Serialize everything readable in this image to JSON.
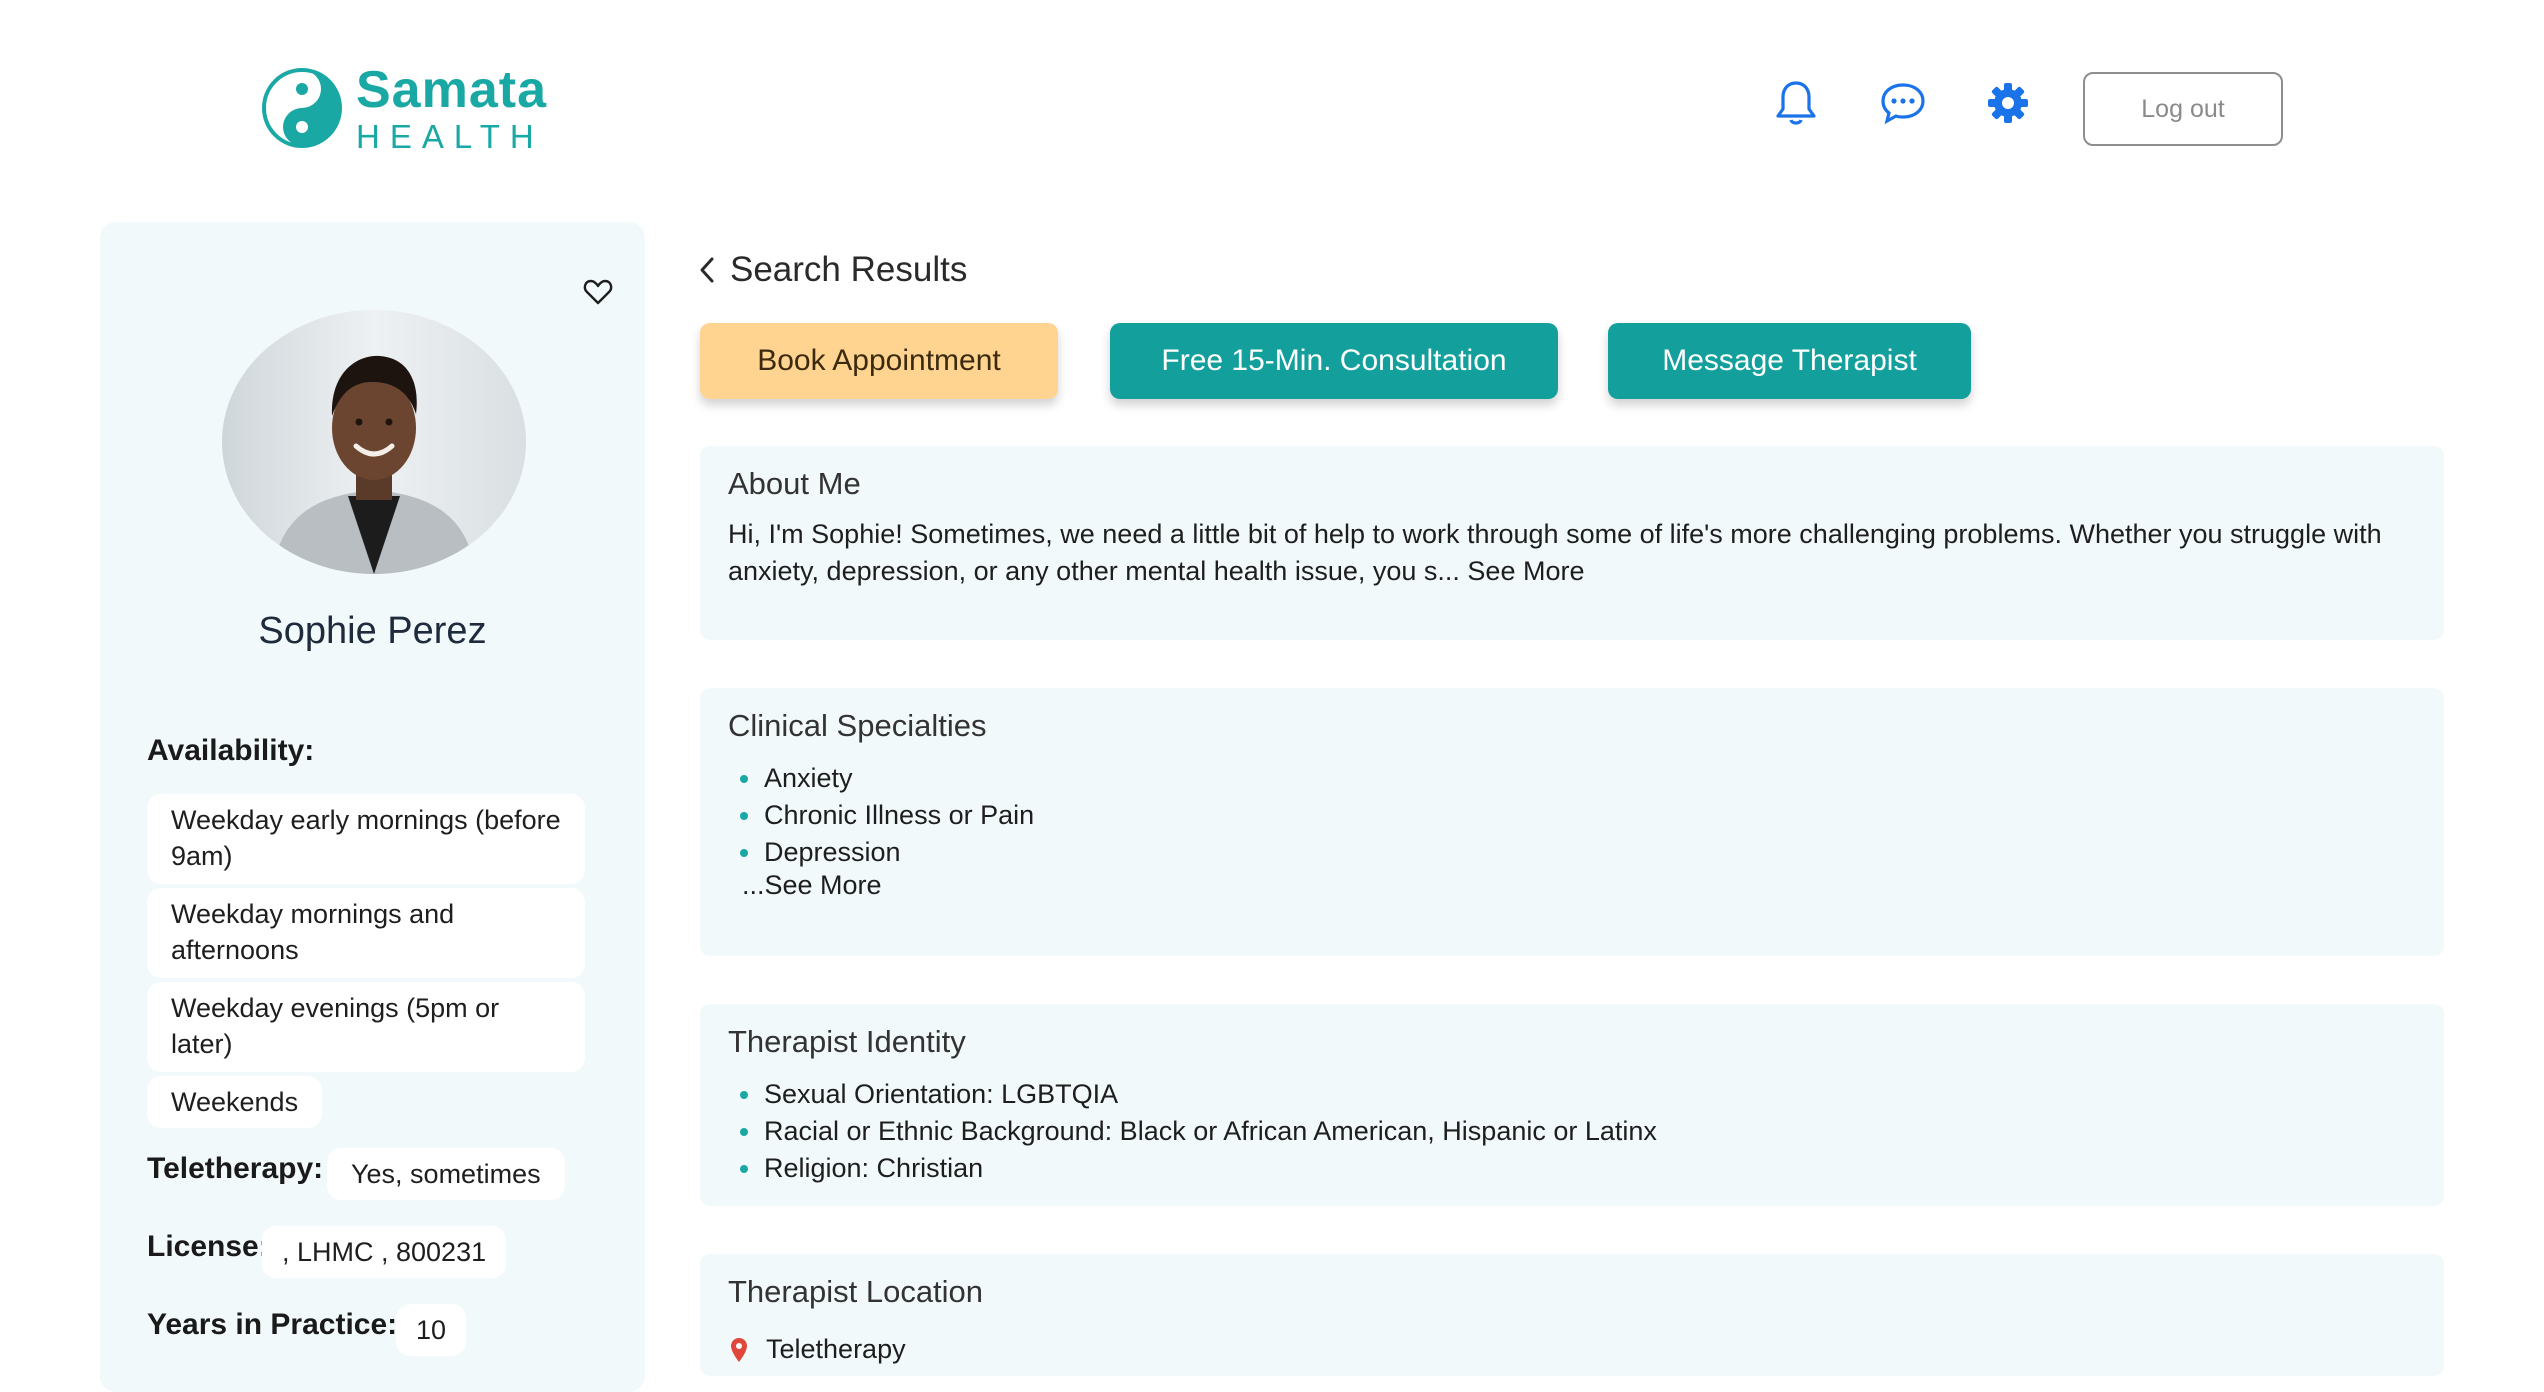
{
  "header": {
    "logo_word1": "Samata",
    "logo_word2": "HEALTH",
    "icons": [
      "bell-icon",
      "chat-icon",
      "gear-icon"
    ],
    "logout_label": "Log out"
  },
  "colors": {
    "brand_teal": "#13a09d",
    "book_button": "#ffd490",
    "icon_blue": "#1a73e8",
    "panel_bg": "#f2f9fb"
  },
  "profile": {
    "name": "Sophie Perez",
    "availability_label": "Availability:",
    "availability": [
      "Weekday early mornings (before 9am)",
      "Weekday mornings and afternoons",
      "Weekday evenings (5pm or later)",
      "Weekends"
    ],
    "teletherapy_label": "Teletherapy:",
    "teletherapy_value": "Yes, sometimes",
    "license_label": "License:",
    "license_value": ", LHMC , 800231",
    "years_label": "Years in Practice:",
    "years_value": "10"
  },
  "nav": {
    "back_label": "Search Results"
  },
  "actions": {
    "book": "Book Appointment",
    "consult": "Free 15-Min. Consultation",
    "message": "Message Therapist"
  },
  "about": {
    "title": "About Me",
    "text": "Hi, I'm Sophie! Sometimes, we need a little bit of help to work through some of life's more challenging problems. Whether you struggle with anxiety, depression, or any other mental health issue, you s...",
    "see_more": "See More"
  },
  "specialties": {
    "title": "Clinical Specialties",
    "items": [
      "Anxiety",
      "Chronic Illness or Pain",
      "Depression"
    ],
    "see_more": "...See More"
  },
  "identity": {
    "title": "Therapist Identity",
    "items": [
      "Sexual Orientation: LGBTQIA",
      "Racial or Ethnic Background: Black or African American, Hispanic or Latinx",
      "Religion: Christian"
    ]
  },
  "location": {
    "title": "Therapist Location",
    "value": "Teletherapy"
  }
}
